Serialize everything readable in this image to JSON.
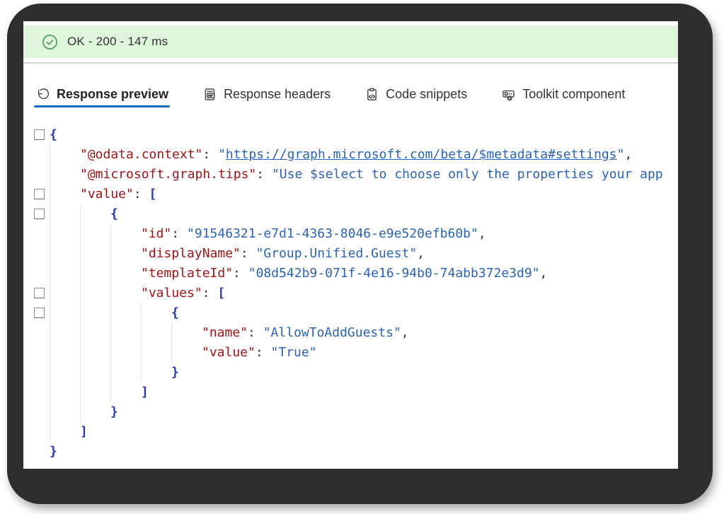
{
  "window": {
    "status": {
      "text": "OK - 200 - 147 ms",
      "icon": "success-check-icon",
      "bg_color": "#dff6dd",
      "icon_color": "#4f9d58",
      "text_color": "#323130"
    },
    "accent_color": "#0f6cbd",
    "tabs": [
      {
        "id": "response-preview",
        "label": "Response preview",
        "icon": "undo-arrow-icon",
        "active": true
      },
      {
        "id": "response-headers",
        "label": "Response headers",
        "icon": "document-chat-icon",
        "active": false
      },
      {
        "id": "code-snippets",
        "label": "Code snippets",
        "icon": "clipboard-code-icon",
        "active": false
      },
      {
        "id": "toolkit-component",
        "label": "Toolkit component",
        "icon": "component-gear-icon",
        "active": false
      }
    ],
    "syntax_colors": {
      "key": "#a31515",
      "string": "#2a63bd",
      "link": "#2a63bd",
      "bracket": "#2438bd",
      "punctuation": "#333333"
    },
    "response_json": {
      "lines": [
        {
          "indent": 0,
          "fold_checkbox": true,
          "tokens": [
            {
              "text": "{",
              "type": "bracket"
            }
          ]
        },
        {
          "indent": 1,
          "fold_checkbox": false,
          "tokens": [
            {
              "text": "\"@odata.context\"",
              "type": "key"
            },
            {
              "text": ": ",
              "type": "punctuation"
            },
            {
              "text": "\"",
              "type": "string"
            },
            {
              "text": "https://graph.microsoft.com/beta/$metadata#settings",
              "type": "link"
            },
            {
              "text": "\"",
              "type": "string"
            },
            {
              "text": ",",
              "type": "punctuation"
            }
          ]
        },
        {
          "indent": 1,
          "fold_checkbox": false,
          "tokens": [
            {
              "text": "\"@microsoft.graph.tips\"",
              "type": "key"
            },
            {
              "text": ": ",
              "type": "punctuation"
            },
            {
              "text": "\"Use $select to choose only the properties your app",
              "type": "string"
            }
          ]
        },
        {
          "indent": 1,
          "fold_checkbox": true,
          "tokens": [
            {
              "text": "\"value\"",
              "type": "key"
            },
            {
              "text": ": ",
              "type": "punctuation"
            },
            {
              "text": "[",
              "type": "bracket"
            }
          ]
        },
        {
          "indent": 2,
          "fold_checkbox": true,
          "tokens": [
            {
              "text": "{",
              "type": "bracket"
            }
          ]
        },
        {
          "indent": 3,
          "fold_checkbox": false,
          "tokens": [
            {
              "text": "\"id\"",
              "type": "key"
            },
            {
              "text": ": ",
              "type": "punctuation"
            },
            {
              "text": "\"91546321-e7d1-4363-8046-e9e520efb60b\"",
              "type": "string"
            },
            {
              "text": ",",
              "type": "punctuation"
            }
          ]
        },
        {
          "indent": 3,
          "fold_checkbox": false,
          "tokens": [
            {
              "text": "\"displayName\"",
              "type": "key"
            },
            {
              "text": ": ",
              "type": "punctuation"
            },
            {
              "text": "\"Group.Unified.Guest\"",
              "type": "string"
            },
            {
              "text": ",",
              "type": "punctuation"
            }
          ]
        },
        {
          "indent": 3,
          "fold_checkbox": false,
          "tokens": [
            {
              "text": "\"templateId\"",
              "type": "key"
            },
            {
              "text": ": ",
              "type": "punctuation"
            },
            {
              "text": "\"08d542b9-071f-4e16-94b0-74abb372e3d9\"",
              "type": "string"
            },
            {
              "text": ",",
              "type": "punctuation"
            }
          ]
        },
        {
          "indent": 3,
          "fold_checkbox": true,
          "tokens": [
            {
              "text": "\"values\"",
              "type": "key"
            },
            {
              "text": ": ",
              "type": "punctuation"
            },
            {
              "text": "[",
              "type": "bracket"
            }
          ]
        },
        {
          "indent": 4,
          "fold_checkbox": true,
          "tokens": [
            {
              "text": "{",
              "type": "bracket"
            }
          ]
        },
        {
          "indent": 5,
          "fold_checkbox": false,
          "tokens": [
            {
              "text": "\"name\"",
              "type": "key"
            },
            {
              "text": ": ",
              "type": "punctuation"
            },
            {
              "text": "\"AllowToAddGuests\"",
              "type": "string"
            },
            {
              "text": ",",
              "type": "punctuation"
            }
          ]
        },
        {
          "indent": 5,
          "fold_checkbox": false,
          "tokens": [
            {
              "text": "\"value\"",
              "type": "key"
            },
            {
              "text": ": ",
              "type": "punctuation"
            },
            {
              "text": "\"True\"",
              "type": "string"
            }
          ]
        },
        {
          "indent": 4,
          "fold_checkbox": false,
          "tokens": [
            {
              "text": "}",
              "type": "bracket"
            }
          ]
        },
        {
          "indent": 3,
          "fold_checkbox": false,
          "tokens": [
            {
              "text": "]",
              "type": "bracket"
            }
          ]
        },
        {
          "indent": 2,
          "fold_checkbox": false,
          "tokens": [
            {
              "text": "}",
              "type": "bracket"
            }
          ]
        },
        {
          "indent": 1,
          "fold_checkbox": false,
          "tokens": [
            {
              "text": "]",
              "type": "bracket"
            }
          ]
        },
        {
          "indent": 0,
          "fold_checkbox": false,
          "tokens": [
            {
              "text": "}",
              "type": "bracket"
            }
          ]
        }
      ]
    }
  }
}
